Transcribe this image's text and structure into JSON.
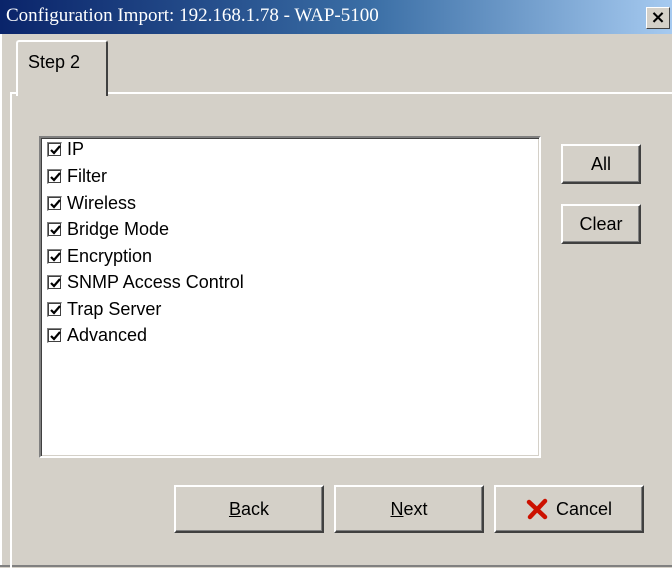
{
  "window": {
    "title": "Configuration Import: 192.168.1.78 - WAP-5100",
    "close_glyph": "×"
  },
  "tab": {
    "label": "Step 2"
  },
  "list": {
    "items": [
      {
        "label": "IP",
        "checked": true
      },
      {
        "label": "Filter",
        "checked": true
      },
      {
        "label": "Wireless",
        "checked": true
      },
      {
        "label": "Bridge Mode",
        "checked": true
      },
      {
        "label": "Encryption",
        "checked": true
      },
      {
        "label": "SNMP Access Control",
        "checked": true
      },
      {
        "label": "Trap Server",
        "checked": true
      },
      {
        "label": "Advanced",
        "checked": true
      }
    ]
  },
  "buttons": {
    "all": "All",
    "clear": "Clear",
    "back_mnemonic": "B",
    "back_rest": "ack",
    "next_mnemonic": "N",
    "next_rest": "ext",
    "cancel": "Cancel",
    "cancel_icon_color": "#cc1100"
  },
  "colors": {
    "titlebar_start": "#0a246a",
    "titlebar_end": "#a6caf0",
    "face": "#d4d0c8"
  }
}
